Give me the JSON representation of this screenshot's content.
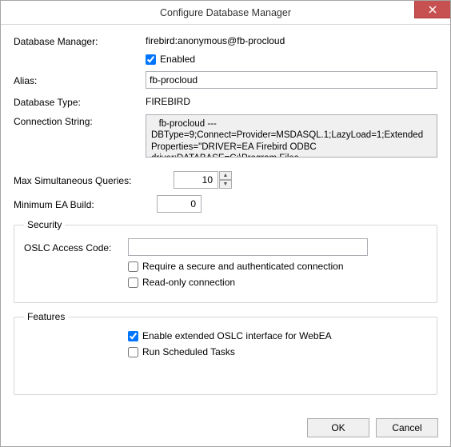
{
  "dialog": {
    "title": "Configure Database Manager"
  },
  "labels": {
    "db_manager": "Database Manager:",
    "enabled": "Enabled",
    "alias": "Alias:",
    "db_type": "Database Type:",
    "conn_string": "Connection String:",
    "max_queries": "Max Simultaneous Queries:",
    "min_build": "Minimum EA Build:",
    "security_legend": "Security",
    "oslc_code": "OSLC Access Code:",
    "require_secure": "Require a secure and authenticated connection",
    "read_only": "Read-only connection",
    "features_legend": "Features",
    "enable_oslc_webea": "Enable extended OSLC interface for WebEA",
    "run_scheduled": "Run Scheduled Tasks",
    "ok": "OK",
    "cancel": "Cancel"
  },
  "values": {
    "db_manager": "firebird:anonymous@fb-procloud",
    "enabled": true,
    "alias": "fb-procloud",
    "db_type": "FIREBIRD",
    "conn_string": "   fb-procloud --- DBType=9;Connect=Provider=MSDASQL.1;LazyLoad=1;Extended Properties=\"DRIVER=EA Firebird ODBC driver;DATABASE=C:\\Program Files",
    "max_queries": "10",
    "min_build": "0",
    "oslc_code": "",
    "require_secure": false,
    "read_only": false,
    "enable_oslc_webea": true,
    "run_scheduled": false
  }
}
